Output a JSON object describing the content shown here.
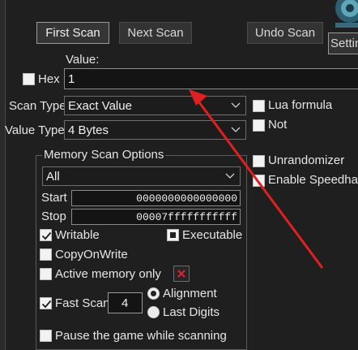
{
  "toolbar": {
    "first_scan": "First Scan",
    "next_scan": "Next Scan",
    "undo_scan": "Undo Scan",
    "settings": "Settin"
  },
  "value": {
    "label": "Value:",
    "hex_label": "Hex",
    "hex_checked": false,
    "input": "1"
  },
  "scan_type": {
    "label": "Scan Type",
    "selected": "Exact Value"
  },
  "value_type": {
    "label": "Value Type",
    "selected": "4 Bytes"
  },
  "right_options": {
    "lua_formula": {
      "label": "Lua formula",
      "checked": false
    },
    "not": {
      "label": "Not",
      "checked": false
    },
    "unrandomizer": {
      "label": "Unrandomizer",
      "checked": false
    },
    "enable_speedhack": {
      "label": "Enable Speedhac",
      "checked": false
    }
  },
  "memory_scan": {
    "title": "Memory Scan Options",
    "region": "All",
    "start_label": "Start",
    "start_value": "0000000000000000",
    "stop_label": "Stop",
    "stop_value": "00007fffffffffff",
    "writable": {
      "label": "Writable",
      "checked": true
    },
    "executable": {
      "label": "Executable",
      "state": "indeterminate"
    },
    "copy_on_write": {
      "label": "CopyOnWrite",
      "checked": false
    },
    "active_memory_only": {
      "label": "Active memory only",
      "checked": false
    },
    "fast_scan": {
      "label": "Fast Scan",
      "checked": true,
      "value": "4"
    },
    "alignment": {
      "label": "Alignment",
      "selected": true
    },
    "last_digits": {
      "label": "Last Digits",
      "selected": false
    },
    "pause_game": {
      "label": "Pause the game while scanning",
      "checked": false
    }
  },
  "annotation": {
    "arrow_color": "#e02020"
  }
}
